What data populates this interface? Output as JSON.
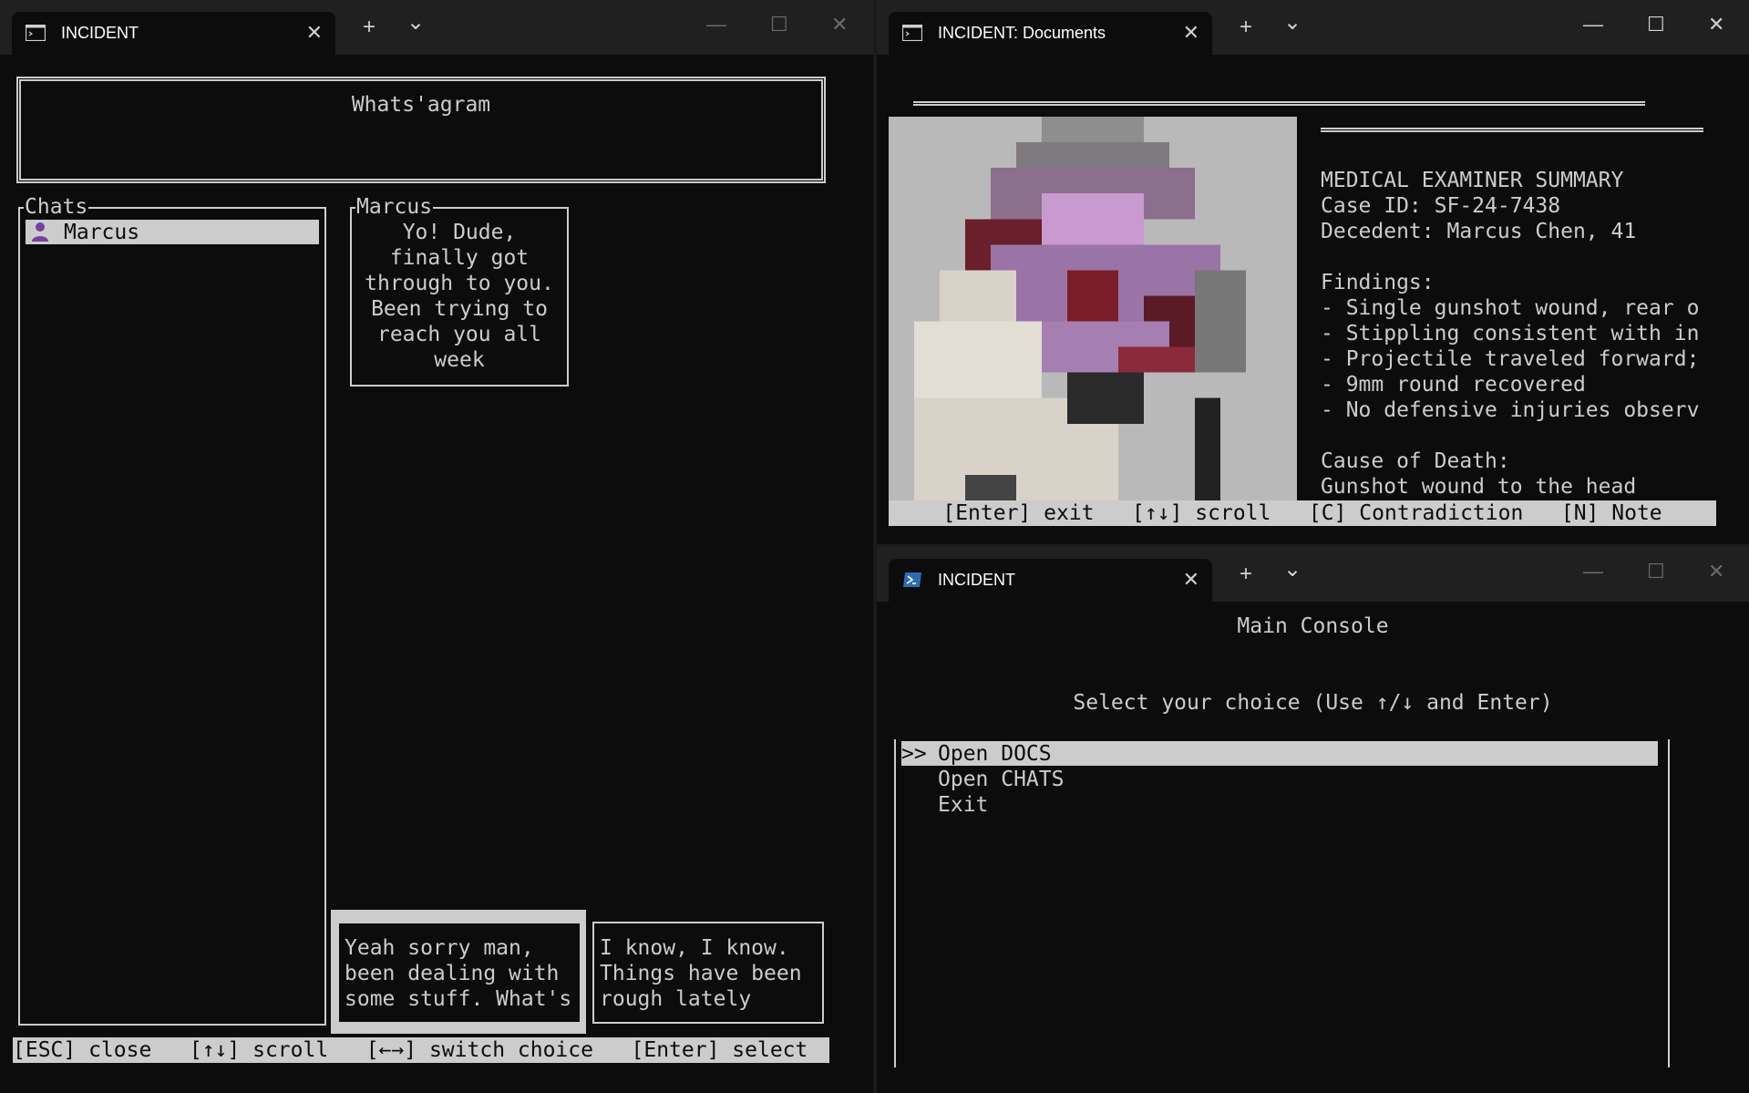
{
  "chat_window": {
    "tab_title": "INCIDENT",
    "app_title": "Whats'agram",
    "chats_label": "Chats",
    "chat_list": [
      "Marcus"
    ],
    "conversation_label": "Marcus",
    "incoming_message": "Yo! Dude,\nfinally got\nthrough to you.\nBeen trying to\nreach you all\nweek",
    "reply_choices": [
      "Yeah sorry man,\nbeen dealing with\nsome stuff. What's",
      "I know, I know.\nThings have been\nrough lately"
    ],
    "help_bar": "[ESC] close   [↑↓] scroll   [←→] switch choice   [Enter] select   [S"
  },
  "docs_window": {
    "tab_title": "INCIDENT: Documents",
    "document_lines": [
      "MEDICAL EXAMINER SUMMARY",
      "Case ID: SF-24-7438",
      "Decedent: Marcus Chen, 41",
      "",
      "Findings:",
      "- Single gunshot wound, rear o",
      "- Stippling consistent with in",
      "- Projectile traveled forward;",
      "- 9mm round recovered",
      "- No defensive injuries observ",
      "",
      "Cause of Death:",
      "Gunshot wound to the head"
    ],
    "help_bar": "[Enter] exit   [↑↓] scroll   [C] Contradiction   [N] Note"
  },
  "console_window": {
    "tab_title": "INCIDENT",
    "heading": "Main Console",
    "prompt": "Select your choice (Use ↑/↓ and Enter)",
    "selected_marker": ">>",
    "options": [
      "Open DOCS",
      "Open CHATS",
      "Exit"
    ]
  },
  "icons": {
    "terminal": "terminal-icon",
    "powershell": "powershell-icon",
    "new_tab": "+",
    "dropdown": "⌄",
    "close": "✕",
    "minimize": "—",
    "maximize": "☐",
    "user": "user-icon"
  },
  "colors": {
    "terminal_bg": "#0c0c0c",
    "titlebar_bg": "#202020",
    "text": "#cccccc",
    "highlight_bg": "#cccccc",
    "user_icon": "#7a3fa0",
    "powershell_blue": "#2e6db4"
  }
}
